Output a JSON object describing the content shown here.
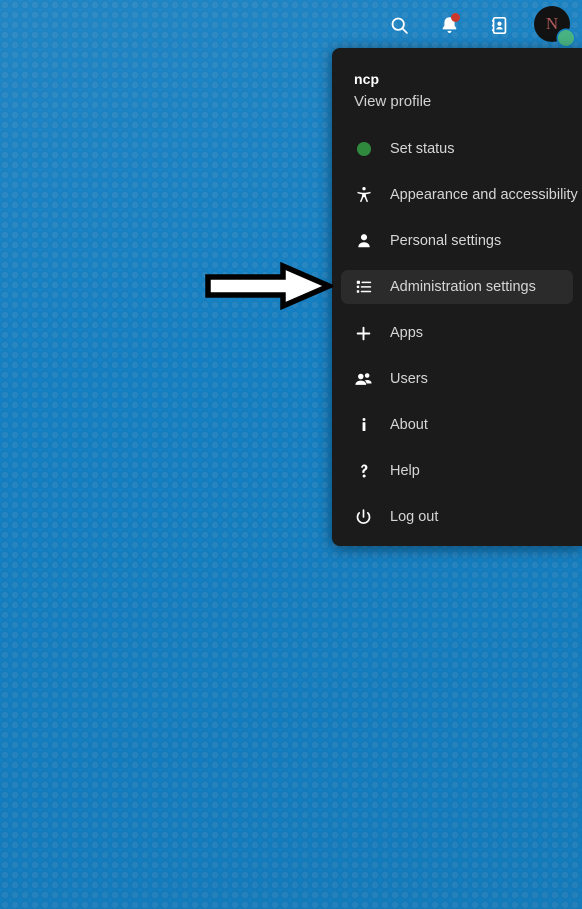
{
  "wallpaper": {
    "color": "#1581c4",
    "pattern": "dotted-grid"
  },
  "topbar": {
    "items": [
      {
        "name": "search",
        "icon": "search-icon",
        "label": "Search"
      },
      {
        "name": "notifications",
        "icon": "bell-icon",
        "label": "Notifications",
        "badge": true,
        "badge_color": "#c9382a"
      },
      {
        "name": "contacts",
        "icon": "contacts-icon",
        "label": "Contacts"
      }
    ],
    "avatar": {
      "initial": "N",
      "status": "online",
      "status_color": "#49b382",
      "background": "#121212"
    }
  },
  "user_menu": {
    "username": "ncp",
    "view_profile": "View profile",
    "panel_color": "#1b1b1b",
    "selected_item": "Administration settings",
    "selected_background": "#2b2b2b",
    "items": [
      {
        "label": "Set status",
        "icon": "status-dot-icon",
        "selected": false
      },
      {
        "label": "Appearance and accessibility",
        "icon": "accessibility-icon",
        "selected": false
      },
      {
        "label": "Personal settings",
        "icon": "person-icon",
        "selected": false
      },
      {
        "label": "Administration settings",
        "icon": "list-settings-icon",
        "selected": true
      },
      {
        "label": "Apps",
        "icon": "plus-icon",
        "selected": false
      },
      {
        "label": "Users",
        "icon": "users-icon",
        "selected": false
      },
      {
        "label": "About",
        "icon": "info-icon",
        "selected": false
      },
      {
        "label": "Help",
        "icon": "question-mark-icon",
        "selected": false
      },
      {
        "label": "Log out",
        "icon": "power-icon",
        "selected": false
      }
    ]
  },
  "annotation": {
    "type": "arrow",
    "direction": "right",
    "points_to": "Administration settings",
    "fill": "#ffffff",
    "stroke": "#000000"
  }
}
